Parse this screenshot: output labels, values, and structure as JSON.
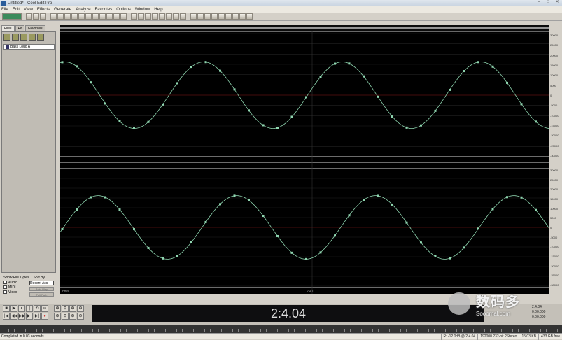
{
  "window": {
    "title": "Untitled* - Cool Edit Pro"
  },
  "menu": [
    "File",
    "Edit",
    "View",
    "Effects",
    "Generate",
    "Analyze",
    "Favorites",
    "Options",
    "Window",
    "Help"
  ],
  "left_panel": {
    "tabs": [
      "Files",
      "Fx",
      "Favorites"
    ],
    "file_item": "Bass Loud A",
    "show_label": "Show File Types",
    "sort_label": "Sort By",
    "sort_value": "Recent Acc",
    "types": [
      "Audio",
      "MIDI",
      "Video"
    ],
    "buttons": [
      "Auto Play",
      "Full Path"
    ]
  },
  "waveform": {
    "top_ruler_left": "hms",
    "top_ruler_mid": "2:4.0",
    "channels": 2,
    "color": "#8fd6b0",
    "centerline_color": "#8a1a1a",
    "axis_labels_top": [
      "30000",
      "25000",
      "20000",
      "15000",
      "10000",
      "5000",
      "0",
      "-5000",
      "-10000",
      "-15000",
      "-20000",
      "-25000",
      "-30000"
    ],
    "axis_labels_bottom": [
      "30000",
      "25000",
      "20000",
      "15000",
      "10000",
      "5000",
      "0",
      "-5000",
      "-10000",
      "-15000",
      "-20000",
      "-25000",
      "-30000"
    ]
  },
  "transport": [
    "■",
    "▶",
    "⏸",
    "||",
    "⟲",
    "∞",
    "|◀",
    "◀◀",
    "▶▶",
    "▶|",
    "▶|",
    "●"
  ],
  "zoom": [
    "⊕",
    "⊖",
    "⊕",
    "⊖",
    "⊕",
    "⊖",
    "⊕",
    "⊖"
  ],
  "time_display": "2:4.04",
  "selection": {
    "begin": "2:4.04",
    "end": "0:00.000",
    "len": "0:00.000"
  },
  "status": {
    "left": "Completed in 0.03 seconds",
    "cells": [
      "R: -12.0dB @ 2:4.04",
      "192000 ?32-bit ?Stereo",
      "15.03 KB",
      "433 GB free"
    ]
  },
  "watermark": {
    "cn": "数码多",
    "en": "Sooomal.com"
  }
}
